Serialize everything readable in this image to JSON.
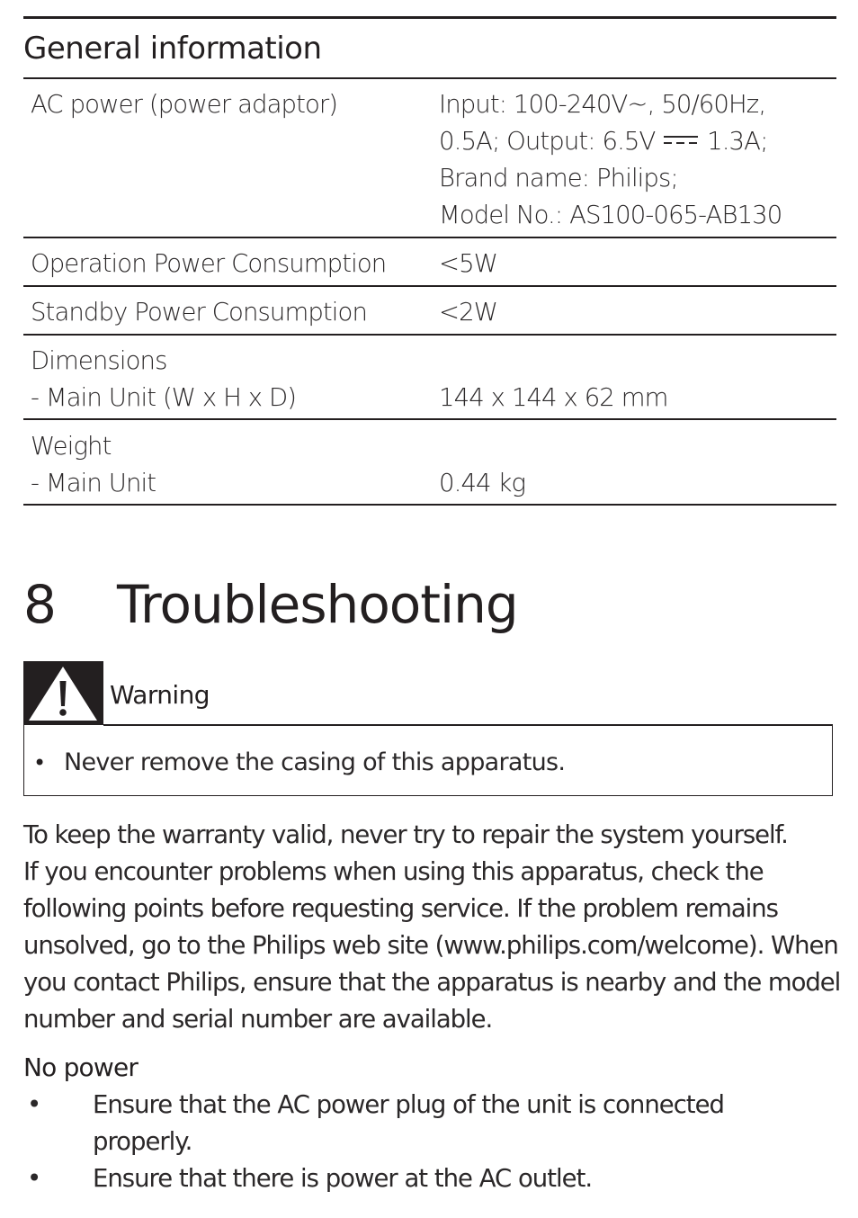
{
  "general_info": {
    "title": "General information",
    "rows": [
      {
        "label_lines": [
          "AC power (power adaptor)"
        ],
        "value_lines": [
          "Input: 100-240V~, 50/60Hz,",
          "0.5A; Output: 6.5V ⎓ 1.3A;",
          "Brand name: Philips;",
          "Model No.: AS100-065-AB130"
        ]
      },
      {
        "label_lines": [
          "Operation Power Consumption"
        ],
        "value_lines": [
          "<5W"
        ]
      },
      {
        "label_lines": [
          "Standby Power Consumption"
        ],
        "value_lines": [
          "<2W"
        ]
      },
      {
        "label_lines": [
          "Dimensions",
          "- Main Unit (W x H x D)"
        ],
        "value_lines": [
          "",
          "144 x 144 x 62 mm"
        ]
      },
      {
        "label_lines": [
          "Weight",
          "- Main Unit"
        ],
        "value_lines": [
          "",
          "0.44 kg"
        ]
      }
    ]
  },
  "chapter": {
    "number": "8",
    "title": "Troubleshooting"
  },
  "warning": {
    "icon": "warning-triangle-icon",
    "label": "Warning",
    "bullet": "•",
    "items": [
      "Never remove the casing of this apparatus."
    ]
  },
  "intro_lines": [
    "To keep the warranty valid, never try to repair the system yourself.",
    "If you encounter problems when using this apparatus, check the",
    "following points before requesting service. If the problem remains",
    "unsolved, go to the Philips web site (www.philips.com/welcome). When",
    "you contact Philips, ensure that the apparatus is nearby and the model",
    "number and serial number are available."
  ],
  "no_power": {
    "heading": "No power",
    "bullet": "•",
    "items": [
      [
        "Ensure that the AC power plug of the unit is connected",
        "properly."
      ],
      [
        "Ensure that there is power at the AC outlet."
      ]
    ]
  }
}
